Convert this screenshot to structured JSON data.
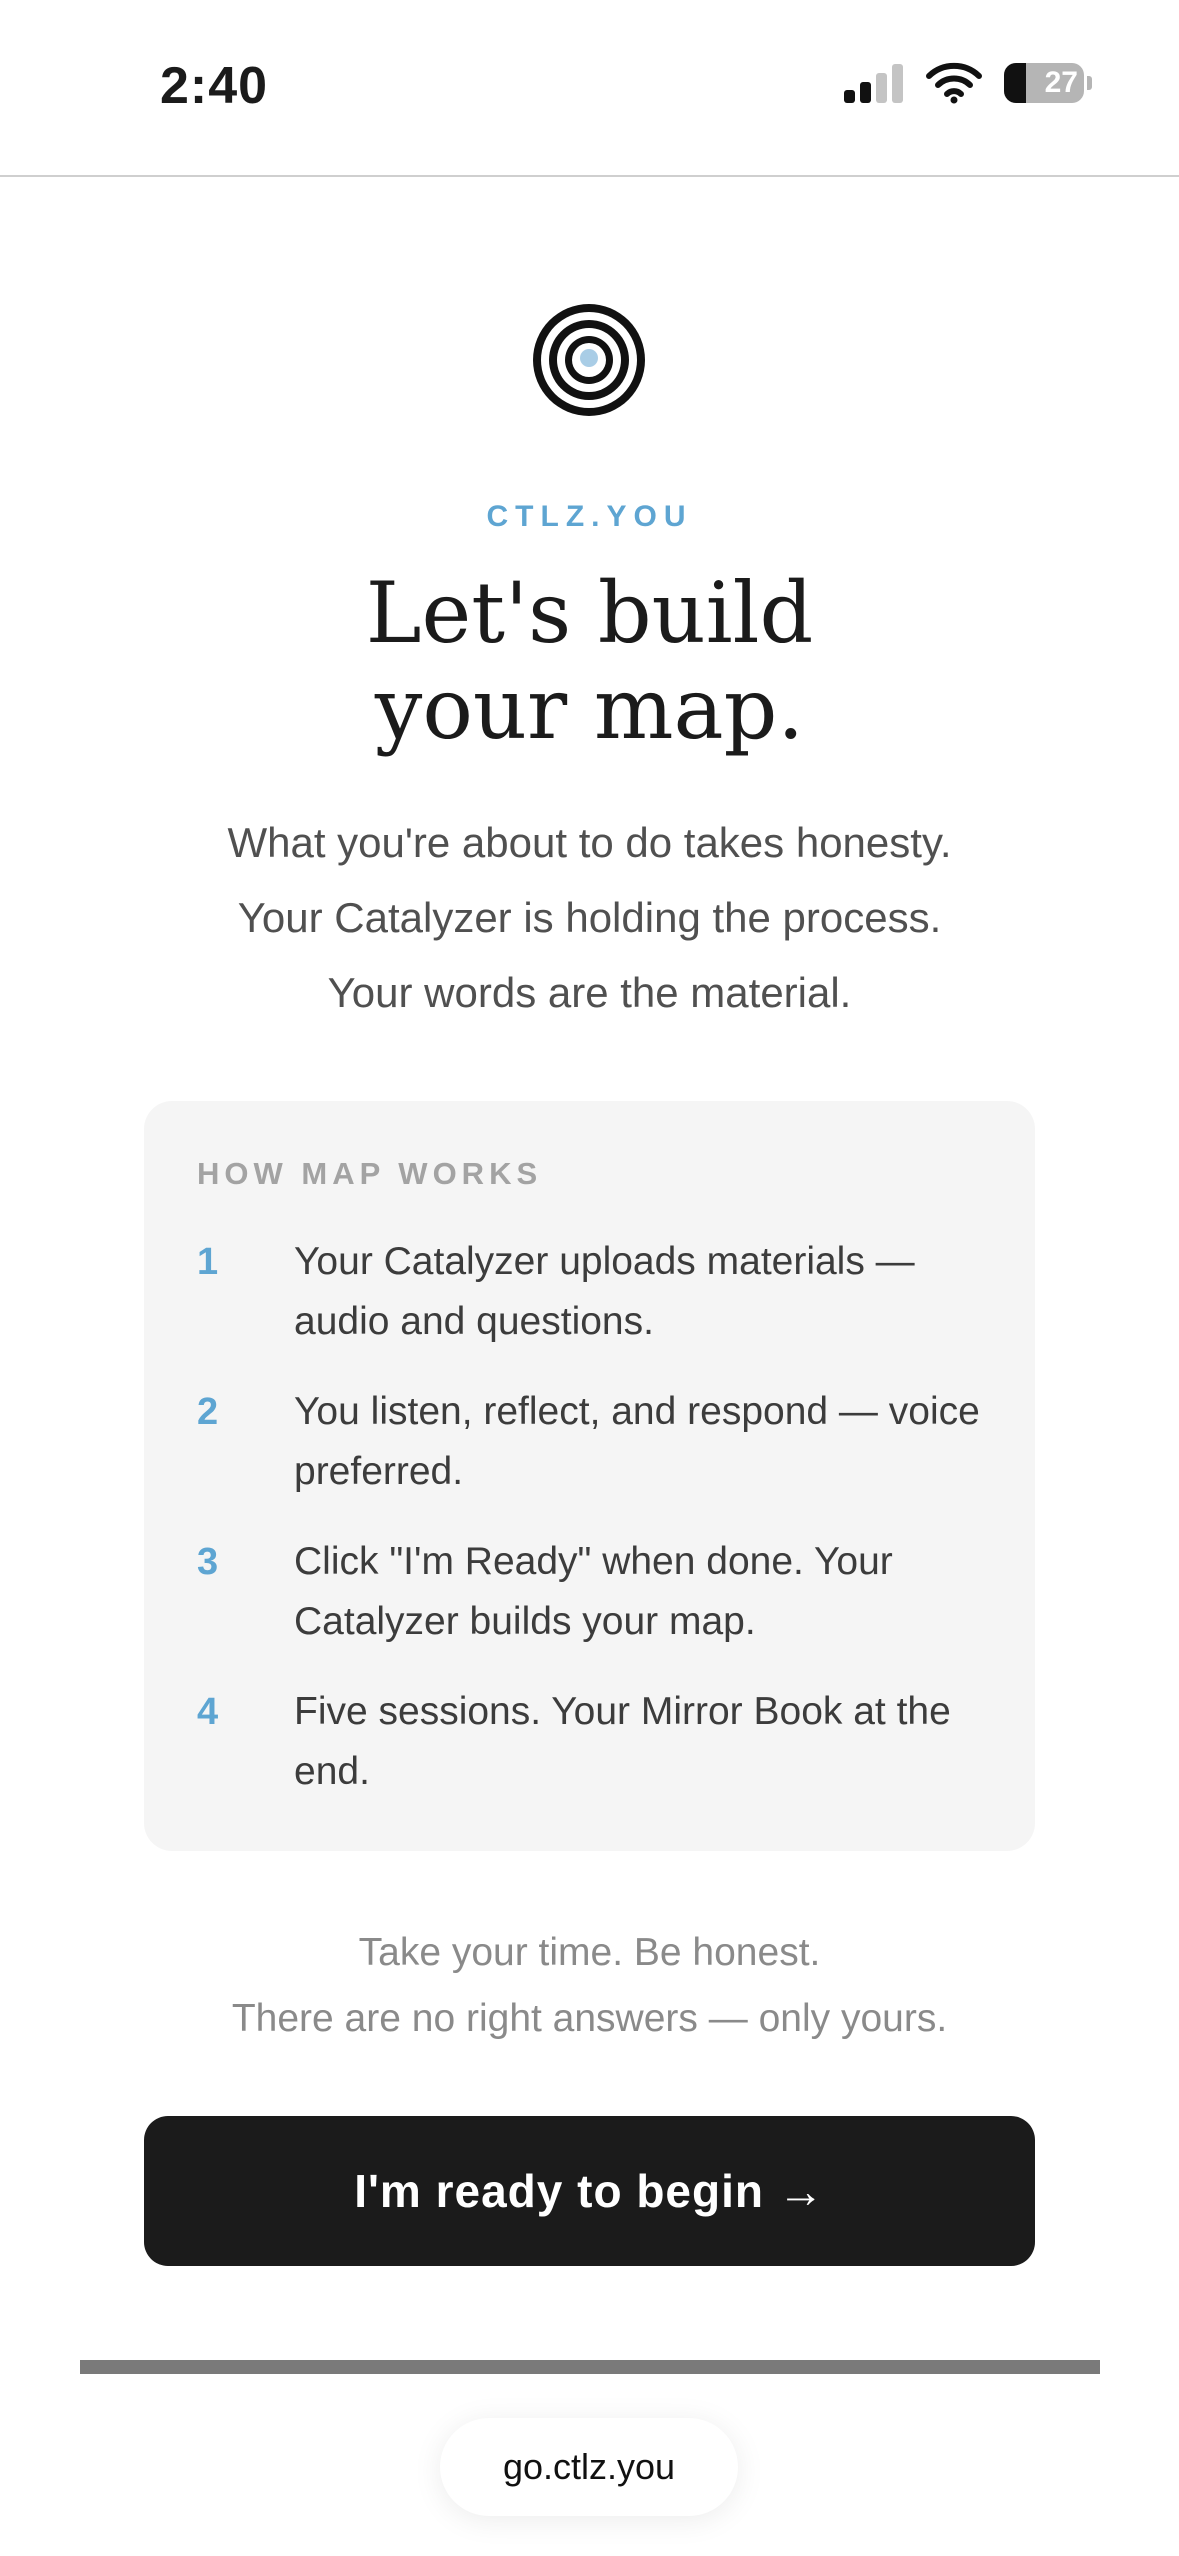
{
  "status_bar": {
    "time": "2:40",
    "battery": "27",
    "icons": [
      "signal-icon",
      "wifi-icon",
      "battery-icon"
    ]
  },
  "colors": {
    "accent": "#5ea5d2",
    "text_dark": "#1b1b1b",
    "card_bg": "#f5f5f5",
    "button_bg": "#1b1b1b"
  },
  "brand": "CTLZ.YOU",
  "headline": {
    "line1": "Let's build",
    "line2": "your map."
  },
  "intro": [
    "What you're about to do takes honesty.",
    "Your Catalyzer is holding the process.",
    "Your words are the material."
  ],
  "how_it_works": {
    "heading": "HOW MAP WORKS",
    "steps": [
      {
        "num": "1",
        "text": "Your Catalyzer uploads materials — audio and questions."
      },
      {
        "num": "2",
        "text": "You listen, reflect, and respond — voice preferred."
      },
      {
        "num": "3",
        "text": "Click \"I'm Ready\" when done. Your Catalyzer builds your map."
      },
      {
        "num": "4",
        "text": "Five sessions. Your Mirror Book at the end."
      }
    ]
  },
  "closing": {
    "line1": "Take your time. Be honest.",
    "line2": "There are no right answers — only yours."
  },
  "cta_label": "I'm ready to begin →",
  "browser": {
    "url": "go.ctlz.you"
  }
}
